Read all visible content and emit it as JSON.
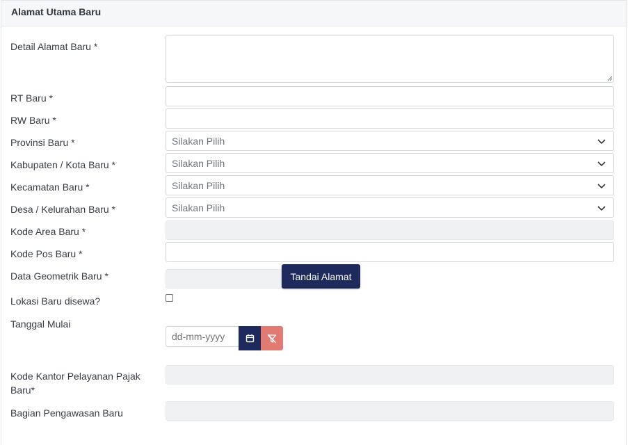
{
  "section": {
    "title": "Alamat Utama Baru"
  },
  "fields": {
    "detail_alamat": {
      "label": "Detail Alamat Baru *",
      "value": ""
    },
    "rt": {
      "label": "RT Baru *",
      "value": ""
    },
    "rw": {
      "label": "RW Baru *",
      "value": ""
    },
    "provinsi": {
      "label": "Provinsi Baru *",
      "selected": "Silakan Pilih"
    },
    "kabupaten": {
      "label": "Kabupaten / Kota Baru *",
      "selected": "Silakan Pilih"
    },
    "kecamatan": {
      "label": "Kecamatan Baru *",
      "selected": "Silakan Pilih"
    },
    "desa": {
      "label": "Desa / Kelurahan Baru *",
      "selected": "Silakan Pilih"
    },
    "kode_area": {
      "label": "Kode Area Baru *",
      "value": ""
    },
    "kode_pos": {
      "label": "Kode Pos Baru *",
      "value": ""
    },
    "data_geometrik": {
      "label": "Data Geometrik Baru *",
      "value": "",
      "button_label": "Tandai Alamat"
    },
    "lokasi_disewa": {
      "label": "Lokasi Baru disewa?",
      "checked": false
    },
    "tanggal_mulai": {
      "label": "Tanggal Mulai",
      "placeholder": "dd-mm-yyyy"
    },
    "kode_kantor": {
      "label_line1": "Kode Kantor Pelayanan Pajak",
      "label_line2": "Baru*",
      "value": ""
    },
    "bagian_pengawasan": {
      "label": "Bagian Pengawasan Baru",
      "value": ""
    }
  },
  "icons": {
    "select": "chevron-down-icon",
    "calendar": "calendar-icon",
    "clear": "filter-clear-icon"
  },
  "colors": {
    "primary": "#1f2a5c",
    "danger": "#e07a73",
    "disabled_bg": "#eef0f2"
  }
}
